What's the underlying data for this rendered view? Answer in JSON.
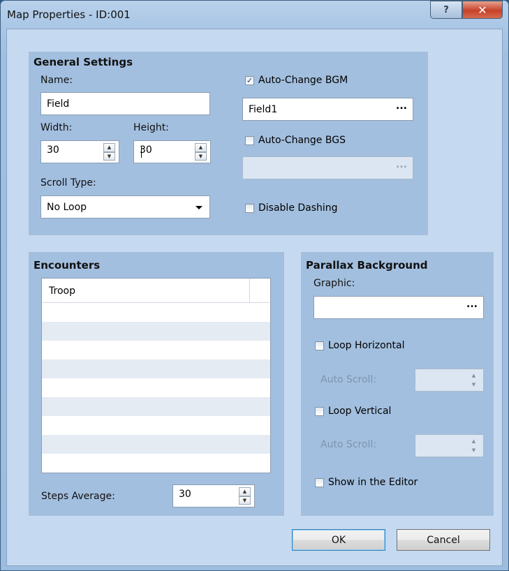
{
  "window": {
    "title": "Map Properties - ID:001",
    "help_glyph": "?",
    "close_glyph": "✕"
  },
  "general": {
    "title": "General Settings",
    "name_label": "Name:",
    "name_value": "Field",
    "width_label": "Width:",
    "width_value": "30",
    "height_label": "Height:",
    "height_value": "30",
    "scroll_label": "Scroll Type:",
    "scroll_value": "No Loop",
    "bgm_label": "Auto-Change BGM",
    "bgm_checked": true,
    "bgm_value": "Field1",
    "bgs_label": "Auto-Change BGS",
    "bgs_checked": false,
    "bgs_value": "",
    "dash_label": "Disable Dashing",
    "dash_checked": false,
    "dots": "···"
  },
  "encounters": {
    "title": "Encounters",
    "column_troop": "Troop",
    "rows": [
      "",
      "",
      "",
      "",
      "",
      "",
      "",
      "",
      "",
      ""
    ],
    "steps_label": "Steps Average:",
    "steps_value": "30"
  },
  "parallax": {
    "title": "Parallax Background",
    "graphic_label": "Graphic:",
    "graphic_value": "",
    "loop_h_label": "Loop Horizontal",
    "loop_h_checked": false,
    "auto_scroll_h_label": "Auto Scroll:",
    "loop_v_label": "Loop Vertical",
    "loop_v_checked": false,
    "auto_scroll_v_label": "Auto Scroll:",
    "show_editor_label": "Show in the Editor",
    "show_editor_checked": false
  },
  "buttons": {
    "ok": "OK",
    "cancel": "Cancel"
  },
  "icons": {
    "help": "help-icon",
    "close": "close-icon",
    "check": "checkmark-icon",
    "dropdown": "chevron-down-icon",
    "spin_up": "spin-up-icon",
    "spin_down": "spin-down-icon",
    "browse": "ellipsis-icon"
  }
}
